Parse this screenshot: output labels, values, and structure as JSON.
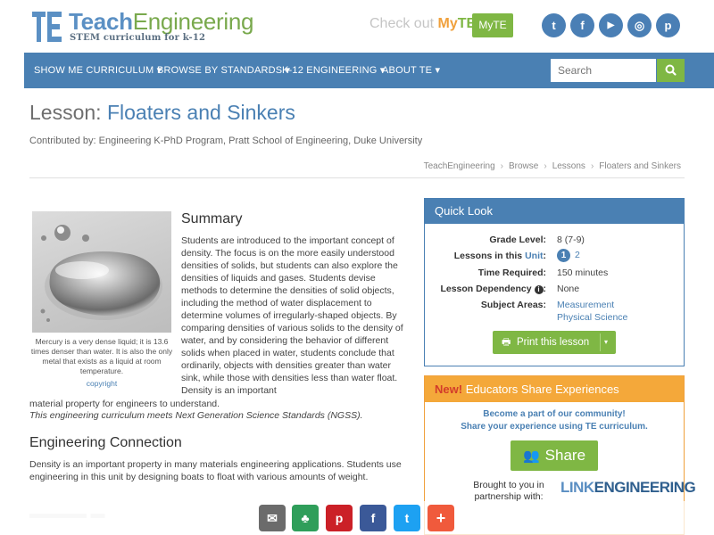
{
  "brand": {
    "name_teach": "Teach",
    "name_engineering": "Engineering",
    "tagline": "STEM curriculum for k-12",
    "checkout_prefix": "Check out",
    "checkout_my": "My",
    "checkout_te": "TE",
    "myte_button": "MyTE",
    "brand_blue": "#4a80b3",
    "brand_green": "#7fb744"
  },
  "social": [
    {
      "icon": "twitter-icon",
      "glyph": "t"
    },
    {
      "icon": "facebook-icon",
      "glyph": "f"
    },
    {
      "icon": "youtube-icon",
      "glyph": "▶"
    },
    {
      "icon": "instagram-icon",
      "glyph": "◎"
    },
    {
      "icon": "pinterest-icon",
      "glyph": "p"
    }
  ],
  "nav": {
    "items": [
      "SHOW ME CURRICULUM ▾",
      "BROWSE BY STANDARDS ▾",
      "K-12 ENGINEERING ▾",
      "ABOUT TE ▾"
    ],
    "search_placeholder": "Search"
  },
  "lesson": {
    "prefix": "Lesson:",
    "title": "Floaters and Sinkers",
    "contributed": "Contributed by: Engineering K-PhD Program, Pratt School of Engineering, Duke University"
  },
  "breadcrumb": [
    "TeachEngineering",
    "Browse",
    "Lessons",
    "Floaters and Sinkers"
  ],
  "summary": {
    "heading": "Summary",
    "caption": "Mercury is a very dense liquid; it is 13.6 times denser than water. It is also the only metal that exists as a liquid at room temperature.",
    "copyright": "copyright",
    "text": "Students are introduced to the important concept of density. The focus is on the more easily understood densities of solids, but students can also explore the densities of liquids and gases. Students devise methods to determine the densities of solid objects, including the method of water displacement to determine volumes of irregularly-shaped objects. By comparing densities of various solids to the density of water, and by considering the behavior of different solids when placed in water, students conclude that ordinarily, objects with densities greater than water sink, while those with densities less than water float. Density is an important",
    "text_tail": "material property for engineers to understand.",
    "ngss": "This engineering curriculum meets Next Generation Science Standards (NGSS)."
  },
  "engineering": {
    "heading": "Engineering Connection",
    "text": "Density is an important property in many materials engineering applications. Students use engineering in this unit by designing boats to float with various amounts of weight."
  },
  "quick_look": {
    "heading": "Quick Look",
    "grade_label": "Grade Level:",
    "grade_value": "8 (7-9)",
    "lessons_label_pre": "Lessons in this",
    "lessons_label_link": "Unit",
    "lesson_current": "1",
    "lesson_other": "2",
    "time_label": "Time Required:",
    "time_value": "150 minutes",
    "dependency_label": "Lesson Dependency",
    "dependency_value": "None",
    "subjects_label": "Subject Areas:",
    "subjects": [
      "Measurement",
      "Physical Science"
    ],
    "print_label": "Print this lesson"
  },
  "educators": {
    "new": "New!",
    "heading": "Educators Share Experiences",
    "line1": "Become a part of our community!",
    "line2": "Share your experience using TE curriculum.",
    "share_label": "Share",
    "brought": "Brought to you in partnership with:",
    "partner_link": "LINK",
    "partner_eng": "ENGINEERING"
  },
  "share_bar": [
    {
      "icon": "email-icon",
      "glyph": "✉",
      "color": "#6b6b6b"
    },
    {
      "icon": "classroom-icon",
      "glyph": "♣",
      "color": "#2f9e5a"
    },
    {
      "icon": "pinterest-icon",
      "glyph": "p",
      "color": "#cb2027"
    },
    {
      "icon": "facebook-icon",
      "glyph": "f",
      "color": "#3b5998"
    },
    {
      "icon": "twitter-icon",
      "glyph": "t",
      "color": "#1da1f2"
    },
    {
      "icon": "more-icon",
      "glyph": "+",
      "color": "#f05a3c"
    }
  ]
}
